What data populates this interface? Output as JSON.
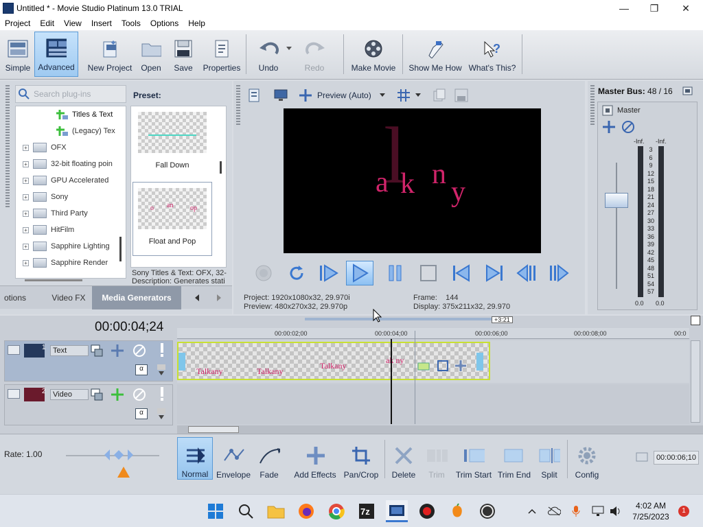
{
  "window": {
    "title": "Untitled * - Movie Studio Platinum 13.0 TRIAL",
    "minimize": "—",
    "maximize": "❐",
    "close": "✕"
  },
  "menu": [
    "Project",
    "Edit",
    "View",
    "Insert",
    "Tools",
    "Options",
    "Help"
  ],
  "toolbar": {
    "simple": "Simple",
    "advanced": "Advanced",
    "new_project": "New Project",
    "open": "Open",
    "save": "Save",
    "properties": "Properties",
    "undo": "Undo",
    "redo": "Redo",
    "make_movie": "Make Movie",
    "show_me_how": "Show Me How",
    "whats_this": "What's This?"
  },
  "plugins": {
    "search_placeholder": "Search plug-ins",
    "tree": [
      "Titles & Text",
      "(Legacy) Tex",
      "OFX",
      "32-bit floating poin",
      "GPU Accelerated",
      "Sony",
      "Third Party",
      "HitFilm",
      "Sapphire Lighting",
      "Sapphire Render"
    ],
    "preset_label": "Preset:",
    "presets": [
      "Fall Down",
      "Float and Pop"
    ],
    "desc_line1": "Sony Titles & Text: OFX, 32-",
    "desc_line2": "Description: Generates stati",
    "tabs": [
      "otions",
      "Video FX",
      "Media Generators"
    ]
  },
  "preview": {
    "mode": "Preview (Auto)",
    "project_label": "Project:",
    "project_value": "1920x1080x32, 29.970i",
    "preview_label": "Preview:",
    "preview_value": "480x270x32, 29.970p",
    "frame_label": "Frame:",
    "frame_value": "144",
    "display_label": "Display:",
    "display_value": "375x211x32, 29.970",
    "letters": [
      "l",
      "a",
      "k",
      "n",
      "y"
    ]
  },
  "master": {
    "title": "Master Bus:",
    "value": "48 / 16",
    "label": "Master",
    "peak_l": "-Inf.",
    "peak_r": "-Inf.",
    "scale": [
      "3",
      "6",
      "9",
      "12",
      "15",
      "18",
      "21",
      "24",
      "27",
      "30",
      "33",
      "36",
      "39",
      "42",
      "45",
      "48",
      "51",
      "54",
      "57"
    ],
    "bottom_l": "0.0",
    "bottom_r": "0.0"
  },
  "timeline": {
    "timecode": "00:00:04;24",
    "ruler": [
      "00:00:02;00",
      "00:00:04;00",
      "00:00:06;00",
      "00:00:08;00",
      "00:0"
    ],
    "loop_label": "+3:21",
    "track1_num": "1",
    "track1_name": "Text",
    "track2_num": "2",
    "track2_name": "Video",
    "clip_texts": [
      "Talkany",
      "Talkany",
      "Talkany",
      "ak ny"
    ]
  },
  "edit": {
    "rate": "Rate: 1.00",
    "normal": "Normal",
    "envelope": "Envelope",
    "fade": "Fade",
    "add_effects": "Add Effects",
    "pan_crop": "Pan/Crop",
    "delete": "Delete",
    "trim": "Trim",
    "trim_start": "Trim Start",
    "trim_end": "Trim End",
    "split": "Split",
    "config": "Config",
    "end_time": "00:00:06;10"
  },
  "taskbar": {
    "time": "4:02 AM",
    "date": "7/25/2023",
    "notif": "1"
  }
}
